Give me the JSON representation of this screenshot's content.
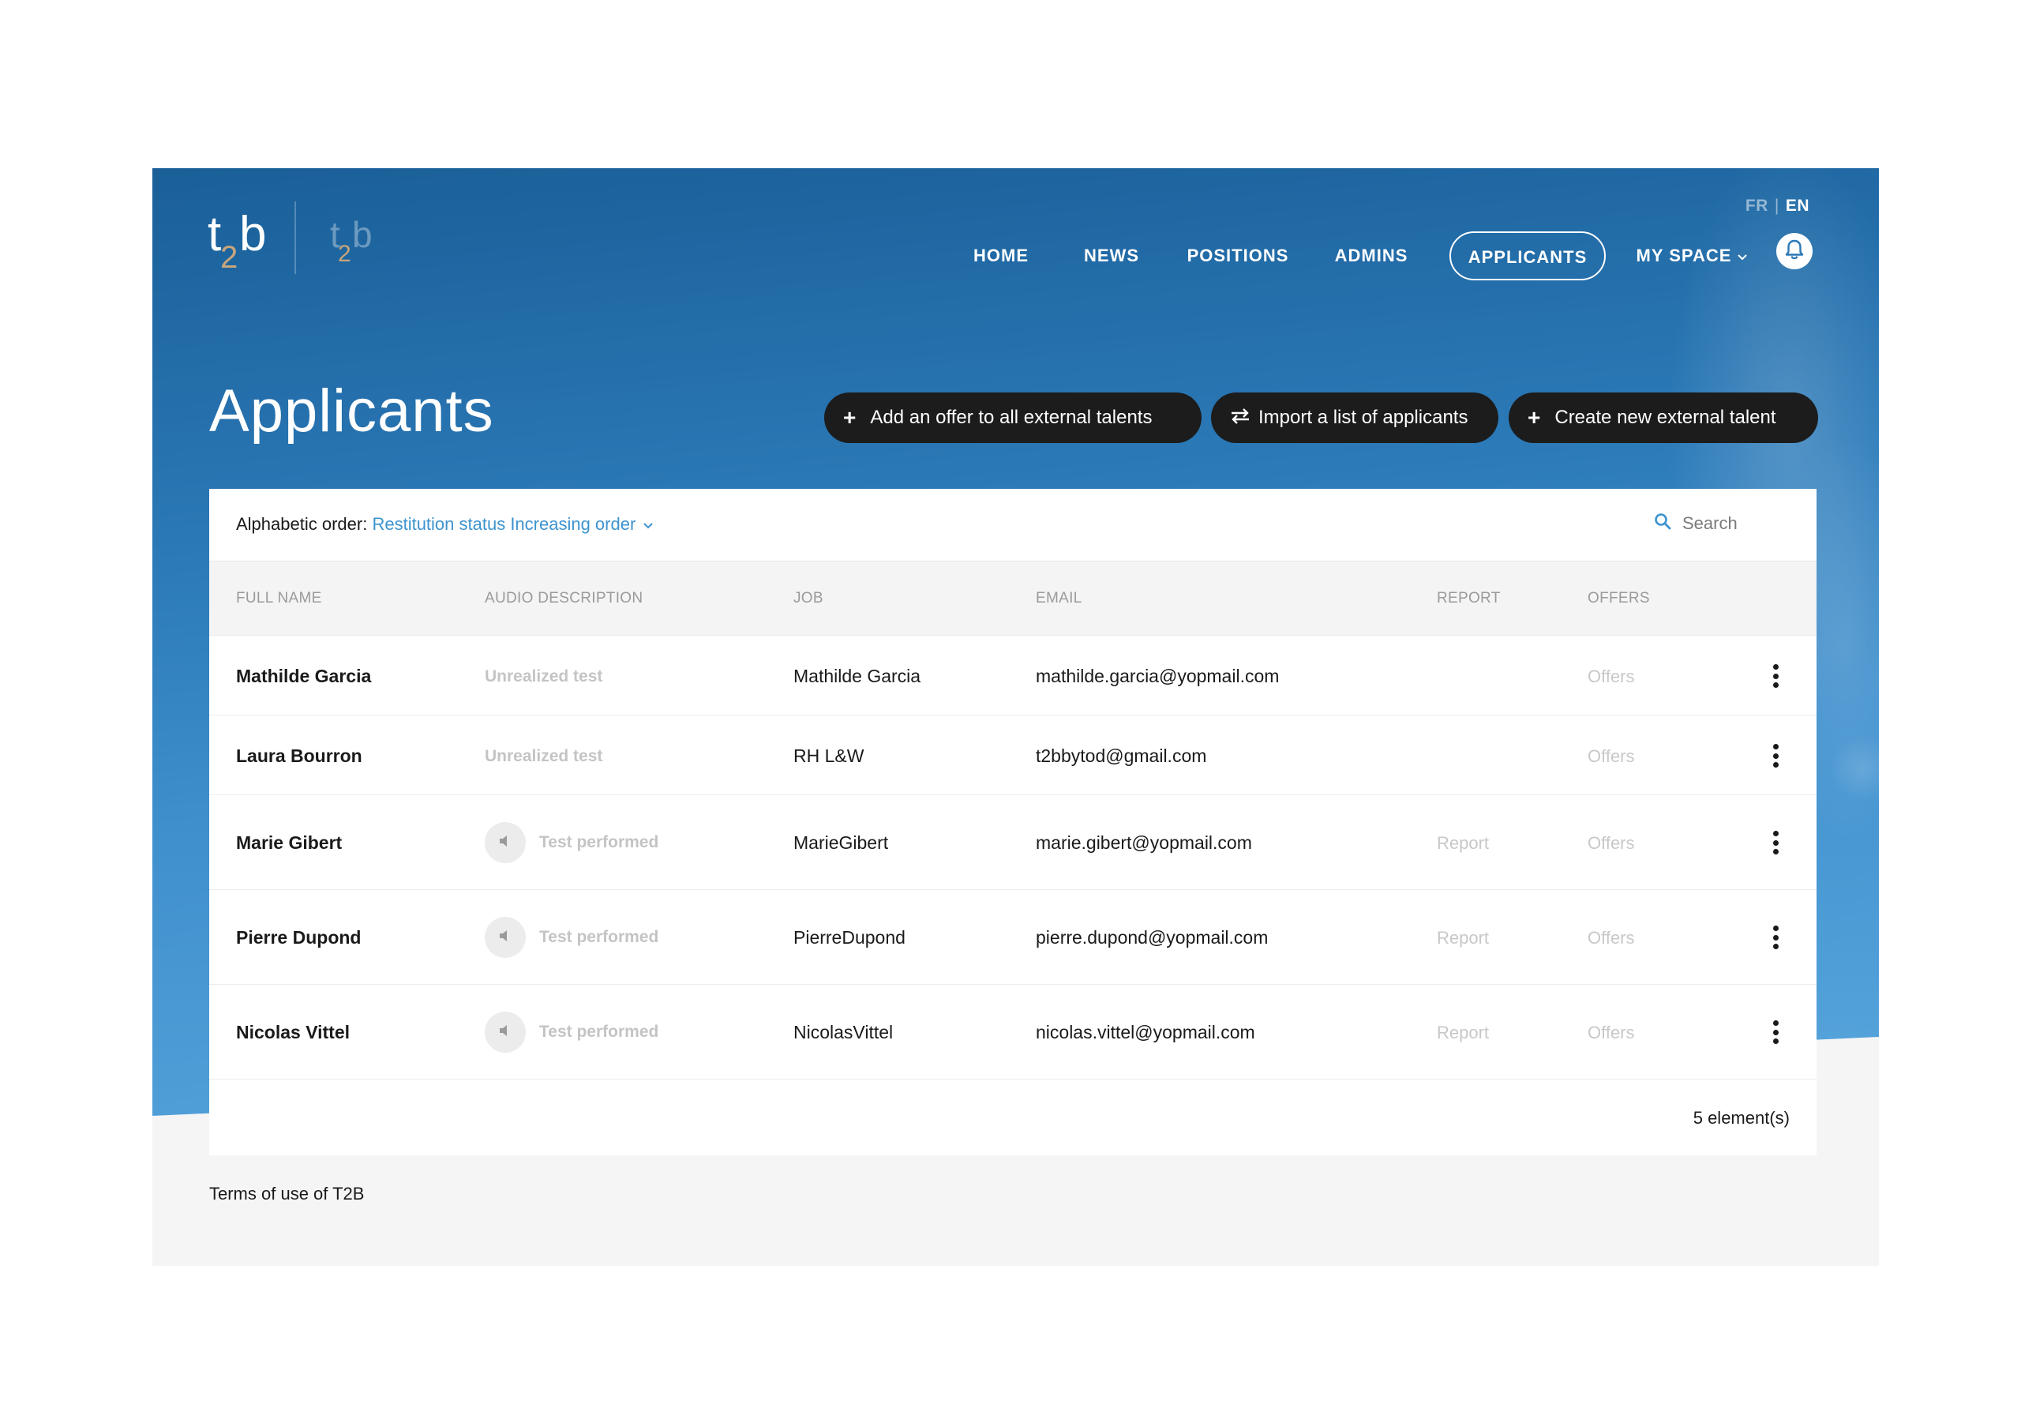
{
  "header": {
    "logo_alt": "t2b",
    "language": {
      "fr": "FR",
      "separator": "|",
      "en": "EN",
      "active": "EN"
    },
    "nav": [
      {
        "label": "HOME"
      },
      {
        "label": "NEWS"
      },
      {
        "label": "POSITIONS"
      },
      {
        "label": "ADMINS"
      },
      {
        "label": "APPLICANTS",
        "active": true
      },
      {
        "label": "MY SPACE",
        "has_dropdown": true
      }
    ],
    "notification_icon": "bell-icon"
  },
  "page": {
    "title": "Applicants",
    "actions": [
      {
        "icon": "plus-icon",
        "label": "Add an offer to all external talents"
      },
      {
        "icon": "swap-arrows-icon",
        "label": "Import a list of applicants"
      },
      {
        "icon": "plus-icon",
        "label": "Create new external talent"
      }
    ]
  },
  "toolbar": {
    "sort_label": "Alphabetic order:",
    "sort_value": "Restitution status Increasing order",
    "search_placeholder": "Search"
  },
  "table": {
    "columns": [
      "FULL NAME",
      "AUDIO DESCRIPTION",
      "JOB",
      "EMAIL",
      "REPORT",
      "OFFERS"
    ],
    "rows": [
      {
        "full_name": "Mathilde Garcia",
        "audio_description": "Unrealized test",
        "has_audio": false,
        "job": "Mathilde Garcia",
        "email": "mathilde.garcia@yopmail.com",
        "report": "",
        "offers": "Offers"
      },
      {
        "full_name": "Laura Bourron",
        "audio_description": "Unrealized test",
        "has_audio": false,
        "job": "RH L&W",
        "email": "t2bbytod@gmail.com",
        "report": "",
        "offers": "Offers"
      },
      {
        "full_name": "Marie Gibert",
        "audio_description": "Test performed",
        "has_audio": true,
        "job": "MarieGibert",
        "email": "marie.gibert@yopmail.com",
        "report": "Report",
        "offers": "Offers"
      },
      {
        "full_name": "Pierre Dupond",
        "audio_description": "Test performed",
        "has_audio": true,
        "job": "PierreDupond",
        "email": "pierre.dupond@yopmail.com",
        "report": "Report",
        "offers": "Offers"
      },
      {
        "full_name": "Nicolas Vittel",
        "audio_description": "Test performed",
        "has_audio": true,
        "job": "NicolasVittel",
        "email": "nicolas.vittel@yopmail.com",
        "report": "Report",
        "offers": "Offers"
      }
    ],
    "count_label": "5 element(s)"
  },
  "footer": {
    "terms_link": "Terms of use of T2B"
  },
  "colors": {
    "header_blue": "#2b79b7",
    "accent_blue": "#3d93cf",
    "button_dark": "#1c1c1c",
    "muted_text": "#c4c4c4"
  }
}
